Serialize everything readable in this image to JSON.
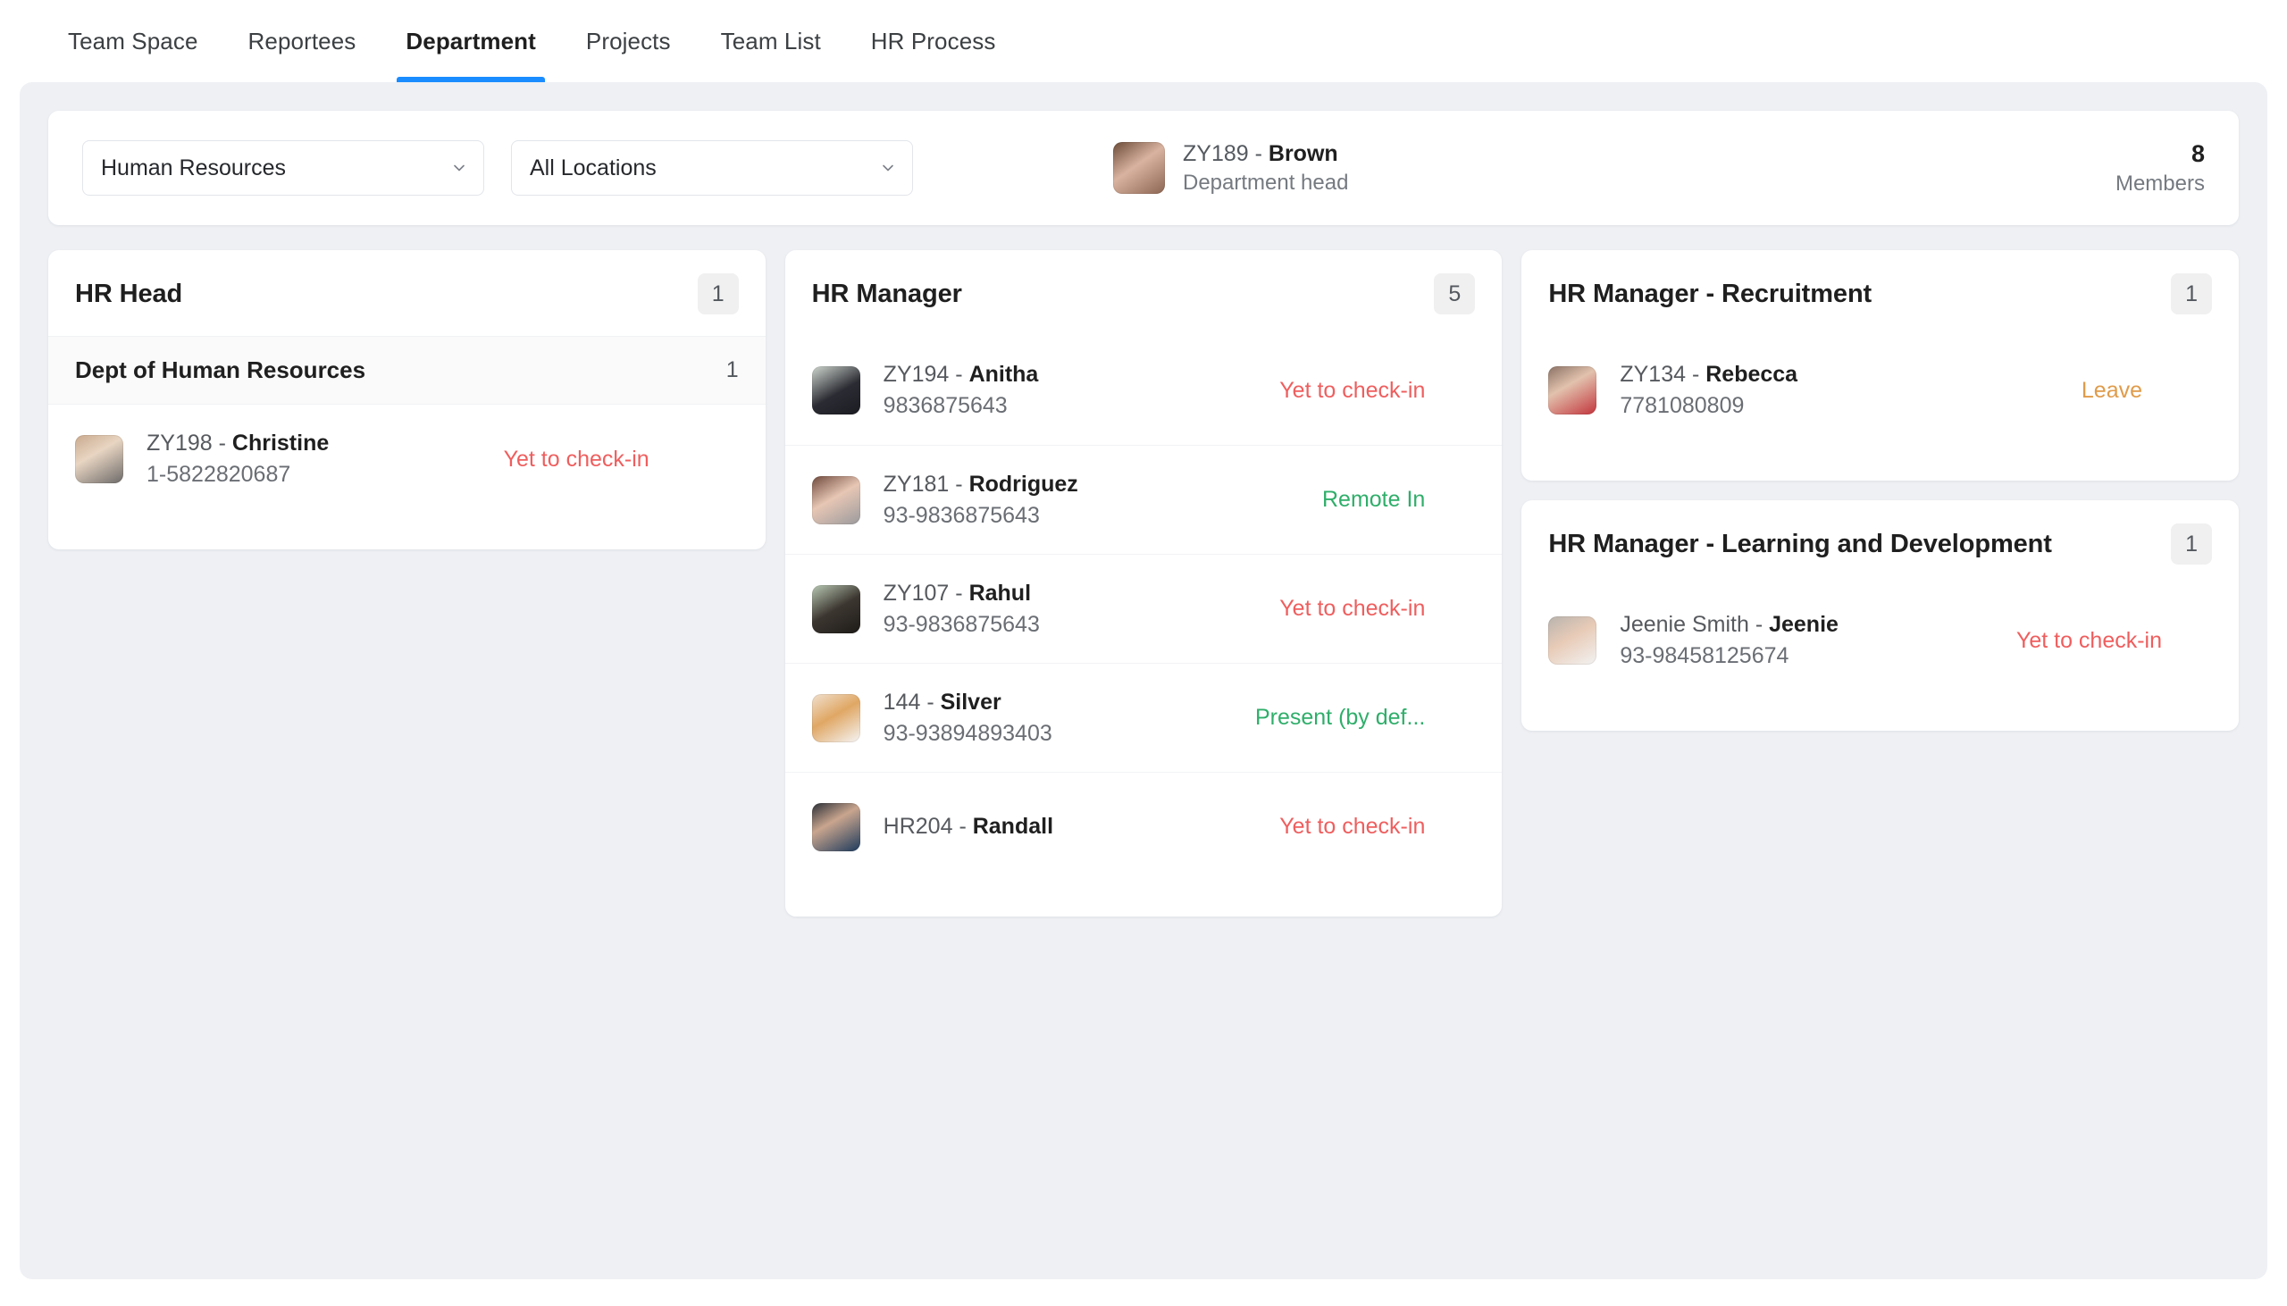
{
  "tabs": [
    {
      "label": "Team Space",
      "active": false
    },
    {
      "label": "Reportees",
      "active": false
    },
    {
      "label": "Department",
      "active": true
    },
    {
      "label": "Projects",
      "active": false
    },
    {
      "label": "Team List",
      "active": false
    },
    {
      "label": "HR Process",
      "active": false
    }
  ],
  "filters": {
    "department": "Human Resources",
    "location": "All Locations"
  },
  "department_head": {
    "id": "ZY189",
    "separator": " - ",
    "name": "Brown",
    "role": "Department head"
  },
  "members_summary": {
    "count": "8",
    "label": "Members"
  },
  "colors": {
    "accent_blue": "#1a8cff",
    "status_pending": "#ef5e5e",
    "status_present": "#2fae6a",
    "status_leave": "#e09b4a",
    "page_background": "#eef0f4",
    "card_background": "#ffffff",
    "badge_background": "#f0f0f1"
  },
  "columns": [
    {
      "cards": [
        {
          "title": "HR Head",
          "badge": "1",
          "subrow": {
            "label": "Dept of Human Resources",
            "count": "1"
          },
          "members": [
            {
              "id": "ZY198",
              "separator": " - ",
              "name": "Christine",
              "phone": "1-5822820687",
              "status": "Yet to check-in",
              "status_type": "pending"
            }
          ]
        }
      ]
    },
    {
      "cards": [
        {
          "title": "HR Manager",
          "badge": "5",
          "subrow": null,
          "members": [
            {
              "id": "ZY194",
              "separator": " - ",
              "name": "Anitha",
              "phone": "9836875643",
              "status": "Yet to check-in",
              "status_type": "pending"
            },
            {
              "id": "ZY181",
              "separator": " - ",
              "name": "Rodriguez",
              "phone": "93-9836875643",
              "status": "Remote In",
              "status_type": "remote"
            },
            {
              "id": "ZY107",
              "separator": " - ",
              "name": "Rahul",
              "phone": "93-9836875643",
              "status": "Yet to check-in",
              "status_type": "pending"
            },
            {
              "id": "144",
              "separator": " - ",
              "name": "Silver",
              "phone": "93-93894893403",
              "status": "Present (by def...",
              "status_type": "present"
            },
            {
              "id": "HR204",
              "separator": " - ",
              "name": "Randall",
              "phone": "",
              "status": "Yet to check-in",
              "status_type": "pending"
            }
          ]
        }
      ]
    },
    {
      "cards": [
        {
          "title": "HR Manager - Recruitment",
          "badge": "1",
          "subrow": null,
          "members": [
            {
              "id": "ZY134",
              "separator": " - ",
              "name": "Rebecca",
              "phone": "7781080809",
              "status": "Leave",
              "status_type": "leave"
            }
          ]
        },
        {
          "title": "HR Manager - Learning and Development",
          "badge": "1",
          "subrow": null,
          "members": [
            {
              "id": "Jeenie Smith",
              "separator": " - ",
              "name": "Jeenie",
              "phone": "93-98458125674",
              "status": "Yet to check-in",
              "status_type": "pending"
            }
          ]
        }
      ]
    }
  ]
}
